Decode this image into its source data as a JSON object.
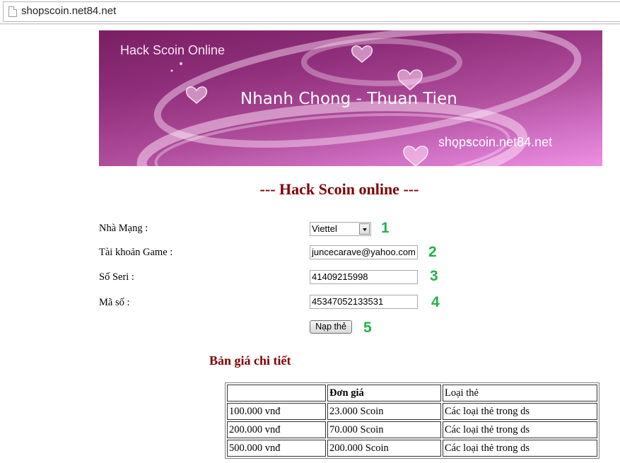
{
  "browser": {
    "url": "shopscoin.net84.net"
  },
  "banner": {
    "title": "Hack Scoin Online",
    "slogan": "Nhanh Chong - Thuan Tien",
    "site": "shopscoin.net84.net"
  },
  "page": {
    "title": "--- Hack Scoin online ---"
  },
  "form": {
    "network": {
      "label": "Nhà Mạng :",
      "value": "Viettel",
      "step": "1"
    },
    "account": {
      "label": "Tài khoản Game :",
      "value": "juncecarave@yahoo.com",
      "step": "2"
    },
    "serial": {
      "label": "Số Seri :",
      "value": "41409215998",
      "step": "3"
    },
    "code": {
      "label": "Mã số :",
      "value": "45347052133531",
      "step": "4"
    },
    "submit": {
      "label": "Nạp thẻ",
      "step": "5"
    }
  },
  "pricing": {
    "title": "Bản giá chi tiết",
    "headers": [
      "",
      "Đơn giá",
      "Loại thẻ"
    ],
    "rows": [
      [
        "100.000 vnđ",
        "23.000 Scoin",
        "Các loại thẻ trong ds"
      ],
      [
        "200.000 vnđ",
        "70.000 Scoin",
        "Các loại thẻ trong ds"
      ],
      [
        "500.000 vnđ",
        "200.000 Scoin",
        "Các loại thẻ trong ds"
      ]
    ]
  }
}
